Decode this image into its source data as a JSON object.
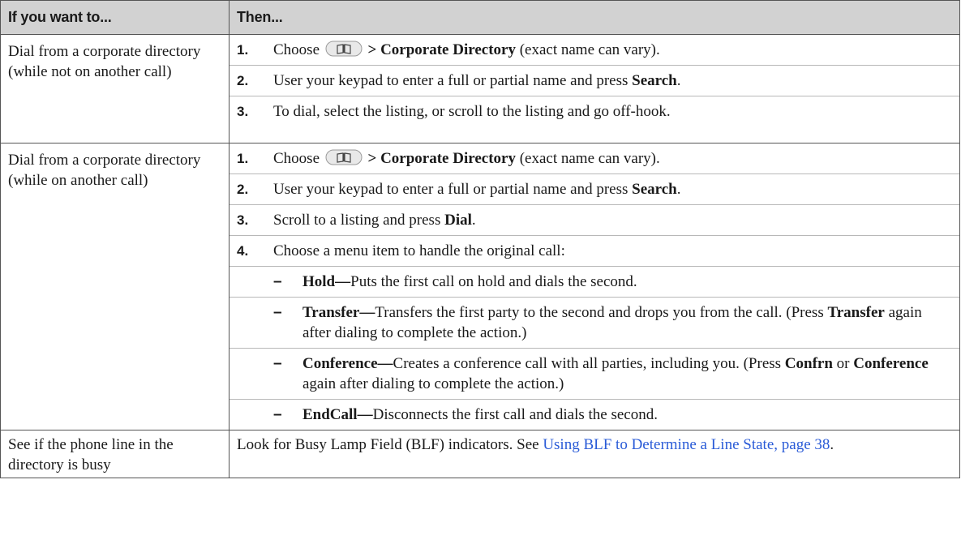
{
  "header": {
    "col1": "If you want to...",
    "col2": "Then..."
  },
  "icon": "directory-book-icon",
  "rows": [
    {
      "condition": "Dial from a corporate directory (while not on another call)",
      "steps": [
        {
          "num": "1.",
          "pre": "Choose",
          "post_bold": " > Corporate Directory",
          "post": " (exact name can vary)."
        },
        {
          "num": "2.",
          "text": "User your keypad to enter a full or partial name and press ",
          "bold": "Search",
          "tail": "."
        },
        {
          "num": "3.",
          "text": "To dial, select the listing, or scroll to the listing and go off-hook."
        }
      ]
    },
    {
      "condition": "Dial from a corporate directory (while on another call)",
      "steps": [
        {
          "num": "1.",
          "pre": "Choose",
          "post_bold": " > Corporate Directory",
          "post": " (exact name can vary)."
        },
        {
          "num": "2.",
          "text": "User your keypad to enter a full or partial name and press ",
          "bold": "Search",
          "tail": "."
        },
        {
          "num": "3.",
          "text": "Scroll to a listing and press ",
          "bold": "Dial",
          "tail": "."
        },
        {
          "num": "4.",
          "text": "Choose a menu item to handle the original call:"
        }
      ],
      "options": [
        {
          "dash": "–",
          "bold": "Hold—",
          "text": "Puts the first call on hold and dials the second."
        },
        {
          "dash": "–",
          "bold": "Transfer—",
          "text": "Transfers the first party to the second and drops you from the call. (Press ",
          "bold2": "Transfer",
          "tail": " again after dialing to complete the action.)"
        },
        {
          "dash": "–",
          "bold": "Conference—",
          "text": "Creates a conference call with all parties, including you. (Press ",
          "bold2": "Confrn",
          "mid": " or ",
          "bold3": "Conference",
          "tail": " again after dialing to complete the action.)"
        },
        {
          "dash": "–",
          "bold": "EndCall—",
          "text": "Disconnects the first call and dials the second."
        }
      ]
    },
    {
      "condition": "See if the phone line in the directory is busy",
      "text": "Look for Busy Lamp Field (BLF) indicators. See ",
      "link": "Using BLF to Determine a Line State, page 38",
      "tail": "."
    }
  ]
}
